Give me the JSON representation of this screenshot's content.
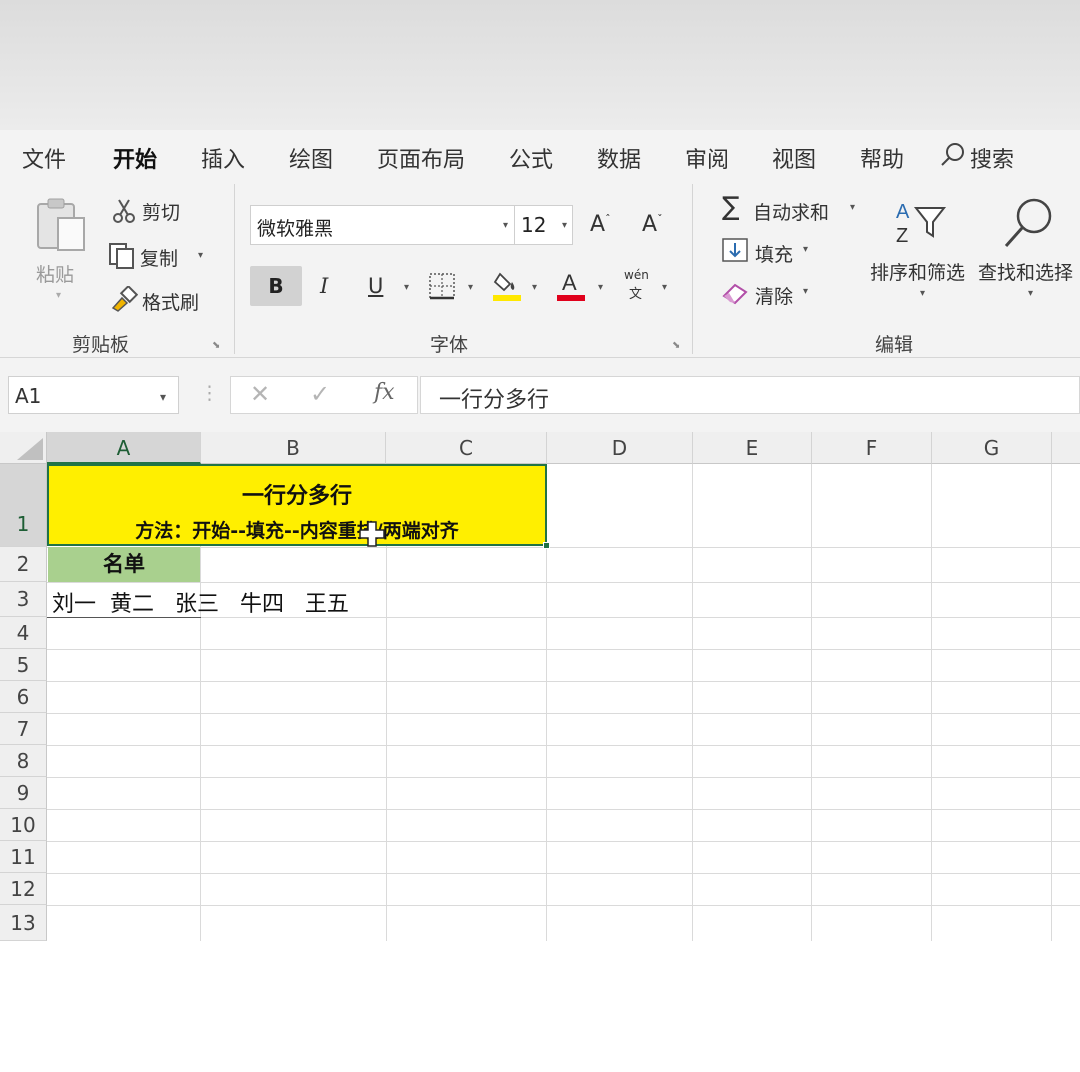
{
  "tabs": [
    {
      "label": "文件",
      "active": false
    },
    {
      "label": "开始",
      "active": true
    },
    {
      "label": "插入",
      "active": false
    },
    {
      "label": "绘图",
      "active": false
    },
    {
      "label": "页面布局",
      "active": false
    },
    {
      "label": "公式",
      "active": false
    },
    {
      "label": "数据",
      "active": false
    },
    {
      "label": "审阅",
      "active": false
    },
    {
      "label": "视图",
      "active": false
    },
    {
      "label": "帮助",
      "active": false
    }
  ],
  "search_label": "搜索",
  "clipboard": {
    "paste": "粘贴",
    "cut": "剪切",
    "copy": "复制",
    "format_painter": "格式刷",
    "group": "剪贴板"
  },
  "font": {
    "family": "微软雅黑",
    "size": "12",
    "bold": "B",
    "italic": "I",
    "underline": "U",
    "group": "字体",
    "phonetic_top": "wén",
    "phonetic_bottom": "文",
    "highlight_color": "#ffe800",
    "font_color": "#e0001b"
  },
  "editing": {
    "autosum": "自动求和",
    "fill": "填充",
    "clear": "清除",
    "sort_filter": "排序和筛选",
    "find_select": "查找和选择",
    "group": "编辑"
  },
  "formula_bar": {
    "name_box": "A1",
    "fx": "fx",
    "content": "一行分多行"
  },
  "grid": {
    "columns": [
      "A",
      "B",
      "C",
      "D",
      "E",
      "F",
      "G"
    ],
    "rows": [
      "1",
      "2",
      "3",
      "4",
      "5",
      "6",
      "7",
      "8",
      "9",
      "10",
      "11",
      "12",
      "13"
    ],
    "selected_column": "A",
    "selected_row": "1"
  },
  "cells": {
    "a1_line1": "一行分多行",
    "a1_line2": "方法：开始--填充--内容重排/两端对齐",
    "a1_fill": "#ffef00",
    "a2": "名单",
    "a2_fill": "#a9d08e",
    "a3": "刘一  黄二   张三   牛四   王五"
  }
}
